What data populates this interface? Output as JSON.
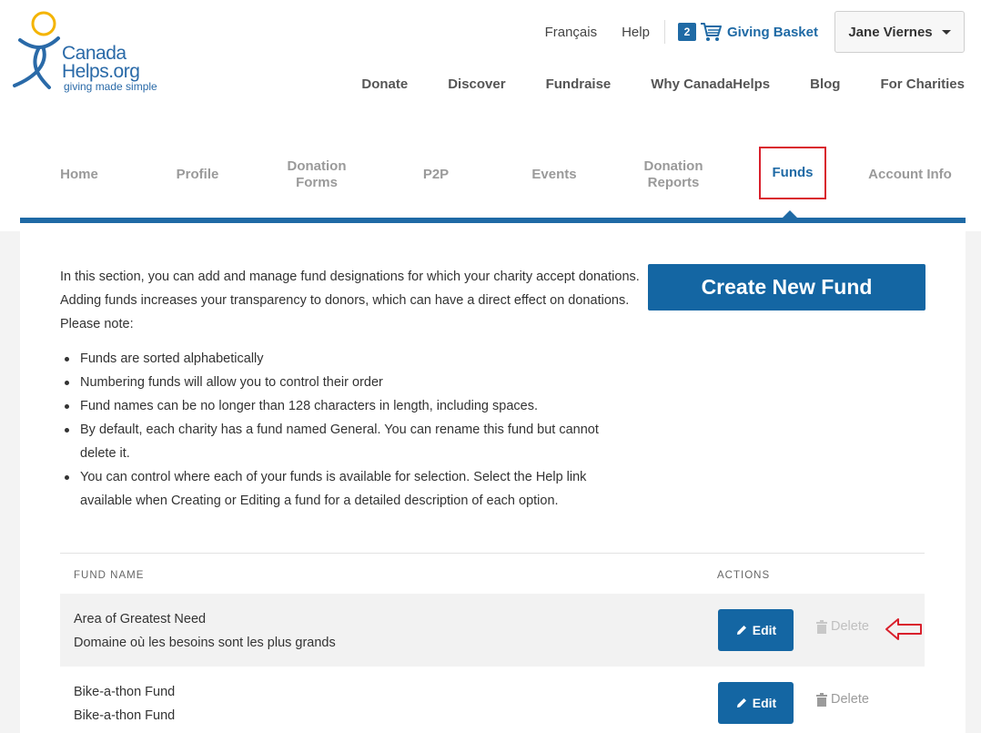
{
  "logo": {
    "line1": "Canada",
    "line2": "Helps.org",
    "tagline": "giving made simple"
  },
  "top_util": {
    "lang": "Français",
    "help": "Help",
    "basket_count": "2",
    "basket_label": "Giving Basket",
    "user_name": "Jane Viernes"
  },
  "main_nav": [
    "Donate",
    "Discover",
    "Fundraise",
    "Why CanadaHelps",
    "Blog",
    "For Charities"
  ],
  "sub_nav": [
    "Home",
    "Profile",
    "Donation Forms",
    "P2P",
    "Events",
    "Donation Reports",
    "Funds",
    "Account Info"
  ],
  "sub_nav_active": "Funds",
  "intro": "In this section, you can add and manage fund designations for which your charity accept donations. Adding funds increases your transparency to donors, which can have a direct effect on donations. Please note:",
  "bullets": [
    "Funds are sorted alphabetically",
    "Numbering funds will allow you to control their order",
    "Fund names can be no longer than 128 characters in length, including spaces.",
    "By default, each charity has a fund named General. You can rename this fund but cannot delete it.",
    "You can control where each of your funds is available for selection. Select the Help link available when Creating or Editing a fund for a detailed description of each option."
  ],
  "create_button": "Create New Fund",
  "table": {
    "col_name": "FUND NAME",
    "col_actions": "ACTIONS",
    "rows": [
      {
        "name": "Area of Greatest Need",
        "name_fr": "Domaine où les besoins sont les plus grands",
        "edit": "Edit",
        "delete": "Delete"
      },
      {
        "name": "Bike-a-thon Fund",
        "name_fr": "Bike-a-thon Fund",
        "edit": "Edit",
        "delete": "Delete"
      }
    ]
  },
  "colors": {
    "brand_blue": "#1466a3",
    "active_outline": "#d9202c",
    "logo_yellow": "#f4b400"
  }
}
